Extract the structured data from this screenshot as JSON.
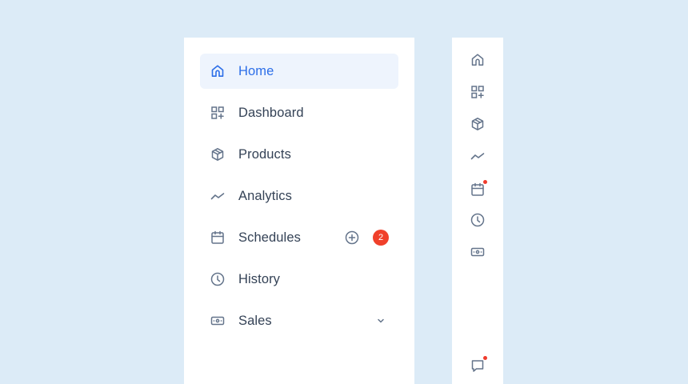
{
  "colors": {
    "background": "#dcebf7",
    "panel": "#ffffff",
    "active_bg": "#eef4fd",
    "active_text": "#2c6ee8",
    "text": "#344256",
    "icon": "#64748b",
    "badge": "#f0402a"
  },
  "sidebar": {
    "items": [
      {
        "label": "Home",
        "icon": "home-icon",
        "active": true
      },
      {
        "label": "Dashboard",
        "icon": "grid-plus-icon"
      },
      {
        "label": "Products",
        "icon": "box-icon"
      },
      {
        "label": "Analytics",
        "icon": "trend-icon"
      },
      {
        "label": "Schedules",
        "icon": "calendar-icon",
        "badge": "2",
        "add_icon": "plus-circle-icon"
      },
      {
        "label": "History",
        "icon": "clock-icon"
      },
      {
        "label": "Sales",
        "icon": "money-icon",
        "expand_icon": "chevron-down-icon"
      }
    ]
  },
  "rail": {
    "items": [
      {
        "icon": "home-icon"
      },
      {
        "icon": "grid-plus-icon"
      },
      {
        "icon": "box-icon"
      },
      {
        "icon": "trend-icon"
      },
      {
        "icon": "calendar-icon",
        "notification": true
      },
      {
        "icon": "clock-icon"
      },
      {
        "icon": "money-icon"
      }
    ],
    "footer": {
      "icon": "message-icon",
      "notification": true
    }
  }
}
